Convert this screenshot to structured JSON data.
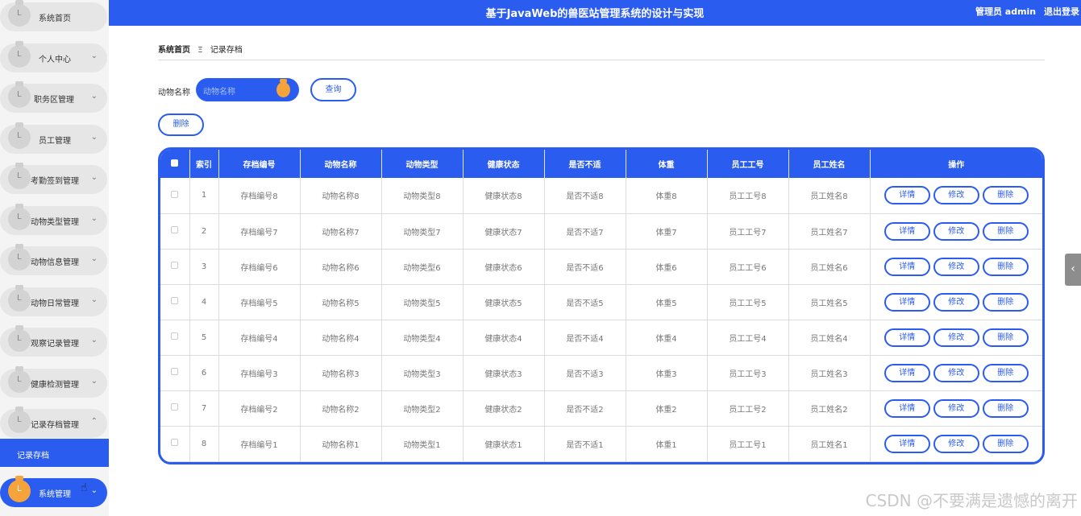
{
  "header": {
    "title": "基于JavaWeb的兽医站管理系统的设计与实现",
    "user_label": "管理员 admin",
    "logout_label": "退出登录"
  },
  "sidebar": {
    "items": [
      {
        "label": "系统首页",
        "chevron": ""
      },
      {
        "label": "个人中心",
        "chevron": "⌄"
      },
      {
        "label": "职务区管理",
        "chevron": "⌄"
      },
      {
        "label": "员工管理",
        "chevron": "⌄"
      },
      {
        "label": "考勤签到管理",
        "chevron": "⌄"
      },
      {
        "label": "动物类型管理",
        "chevron": "⌄"
      },
      {
        "label": "动物信息管理",
        "chevron": "⌄"
      },
      {
        "label": "动物日常管理",
        "chevron": "⌄"
      },
      {
        "label": "观察记录管理",
        "chevron": "⌄"
      },
      {
        "label": "健康检测管理",
        "chevron": "⌄"
      },
      {
        "label": "记录存档管理",
        "chevron": "⌃"
      }
    ],
    "submenu_label": "记录存档",
    "system_item": {
      "label": "系统管理",
      "chevron": "⌄"
    }
  },
  "breadcrumb": {
    "home": "系统首页",
    "separator": "Ξ",
    "current": "记录存档"
  },
  "search": {
    "label": "动物名称",
    "placeholder": "动物名称",
    "query_button": "查询",
    "delete_button": "删除"
  },
  "table": {
    "headers": [
      "",
      "索引",
      "存档编号",
      "动物名称",
      "动物类型",
      "健康状态",
      "是否不适",
      "体重",
      "员工工号",
      "员工姓名",
      "操作"
    ],
    "rows": [
      {
        "index": "1",
        "archive_no": "存档编号8",
        "animal_name": "动物名称8",
        "animal_type": "动物类型8",
        "health": "健康状态8",
        "discomfort": "是否不适8",
        "weight": "体重8",
        "emp_no": "员工工号8",
        "emp_name": "员工姓名8"
      },
      {
        "index": "2",
        "archive_no": "存档编号7",
        "animal_name": "动物名称7",
        "animal_type": "动物类型7",
        "health": "健康状态7",
        "discomfort": "是否不适7",
        "weight": "体重7",
        "emp_no": "员工工号7",
        "emp_name": "员工姓名7"
      },
      {
        "index": "3",
        "archive_no": "存档编号6",
        "animal_name": "动物名称6",
        "animal_type": "动物类型6",
        "health": "健康状态6",
        "discomfort": "是否不适6",
        "weight": "体重6",
        "emp_no": "员工工号6",
        "emp_name": "员工姓名6"
      },
      {
        "index": "4",
        "archive_no": "存档编号5",
        "animal_name": "动物名称5",
        "animal_type": "动物类型5",
        "health": "健康状态5",
        "discomfort": "是否不适5",
        "weight": "体重5",
        "emp_no": "员工工号5",
        "emp_name": "员工姓名5"
      },
      {
        "index": "5",
        "archive_no": "存档编号4",
        "animal_name": "动物名称4",
        "animal_type": "动物类型4",
        "health": "健康状态4",
        "discomfort": "是否不适4",
        "weight": "体重4",
        "emp_no": "员工工号4",
        "emp_name": "员工姓名4"
      },
      {
        "index": "6",
        "archive_no": "存档编号3",
        "animal_name": "动物名称3",
        "animal_type": "动物类型3",
        "health": "健康状态3",
        "discomfort": "是否不适3",
        "weight": "体重3",
        "emp_no": "员工工号3",
        "emp_name": "员工姓名3"
      },
      {
        "index": "7",
        "archive_no": "存档编号2",
        "animal_name": "动物名称2",
        "animal_type": "动物类型2",
        "health": "健康状态2",
        "discomfort": "是否不适2",
        "weight": "体重2",
        "emp_no": "员工工号2",
        "emp_name": "员工姓名2"
      },
      {
        "index": "8",
        "archive_no": "存档编号1",
        "animal_name": "动物名称1",
        "animal_type": "动物类型1",
        "health": "健康状态1",
        "discomfort": "是否不适1",
        "weight": "体重1",
        "emp_no": "员工工号1",
        "emp_name": "员工姓名1"
      }
    ],
    "actions": {
      "detail": "详情",
      "edit": "修改",
      "delete": "删除"
    }
  },
  "side_tab_icon": "chevron-left-icon",
  "watermark": "CSDN @不要满是遗憾的离开",
  "colors": {
    "primary": "#2a5cf0",
    "accent": "#f4a43a",
    "sidebar_bg": "#f4f4f4"
  }
}
